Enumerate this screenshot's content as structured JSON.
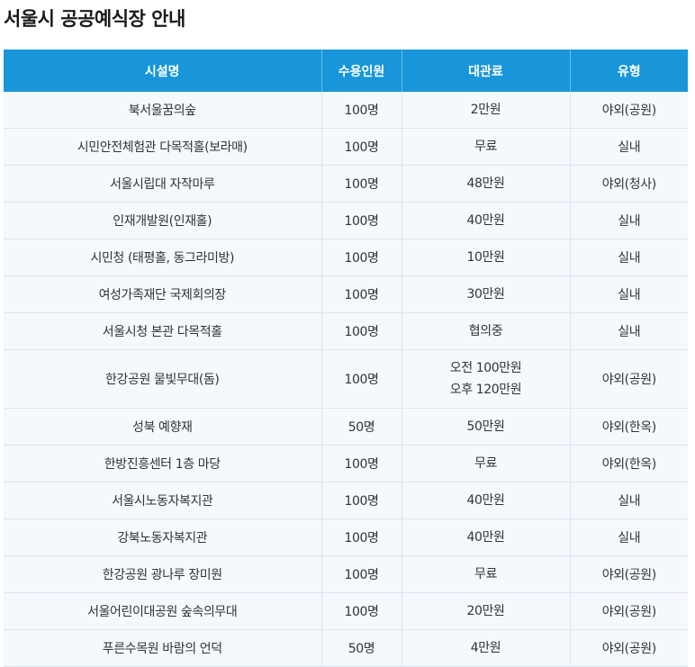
{
  "title": "서울시 공공예식장 안내",
  "table": {
    "headers": [
      "시설명",
      "수용인원",
      "대관료",
      "유형"
    ],
    "rows": [
      {
        "name": "북서울꿈의숲",
        "capacity": "100명",
        "fee": [
          "2만원"
        ],
        "type": "야외(공원)"
      },
      {
        "name": "시민안전체험관 다목적홀(보라매)",
        "capacity": "100명",
        "fee": [
          "무료"
        ],
        "type": "실내"
      },
      {
        "name": "서울시립대 자작마루",
        "capacity": "100명",
        "fee": [
          "48만원"
        ],
        "type": "야외(청사)"
      },
      {
        "name": "인재개발원(인재홀)",
        "capacity": "100명",
        "fee": [
          "40만원"
        ],
        "type": "실내"
      },
      {
        "name": "시민청 (태평홀, 동그라미방)",
        "capacity": "100명",
        "fee": [
          "10만원"
        ],
        "type": "실내"
      },
      {
        "name": "여성가족재단 국제회의장",
        "capacity": "100명",
        "fee": [
          "30만원"
        ],
        "type": "실내"
      },
      {
        "name": "서울시청 본관 다목적홀",
        "capacity": "100명",
        "fee": [
          "협의중"
        ],
        "type": "실내"
      },
      {
        "name": "한강공원 물빛무대(돔)",
        "capacity": "100명",
        "fee": [
          "오전 100만원",
          "오후 120만원"
        ],
        "type": "야외(공원)"
      },
      {
        "name": "성북 예향재",
        "capacity": "50명",
        "fee": [
          "50만원"
        ],
        "type": "야외(한옥)"
      },
      {
        "name": "한방진흥센터 1층 마당",
        "capacity": "100명",
        "fee": [
          "무료"
        ],
        "type": "야외(한옥)"
      },
      {
        "name": "서울시노동자복지관",
        "capacity": "100명",
        "fee": [
          "40만원"
        ],
        "type": "실내"
      },
      {
        "name": "강북노동자복지관",
        "capacity": "100명",
        "fee": [
          "40만원"
        ],
        "type": "실내"
      },
      {
        "name": "한강공원 광나루 장미원",
        "capacity": "100명",
        "fee": [
          "무료"
        ],
        "type": "야외(공원)"
      },
      {
        "name": "서울어린이대공원 숲속의무대",
        "capacity": "100명",
        "fee": [
          "20만원"
        ],
        "type": "야외(공원)"
      },
      {
        "name": "푸른수목원 바람의 언덕",
        "capacity": "50명",
        "fee": [
          "4만원"
        ],
        "type": "야외(공원)"
      }
    ]
  },
  "colors": {
    "header_bg": "#1996d9",
    "row_bg": "#f3f9fd",
    "border": "#dde5ec"
  }
}
